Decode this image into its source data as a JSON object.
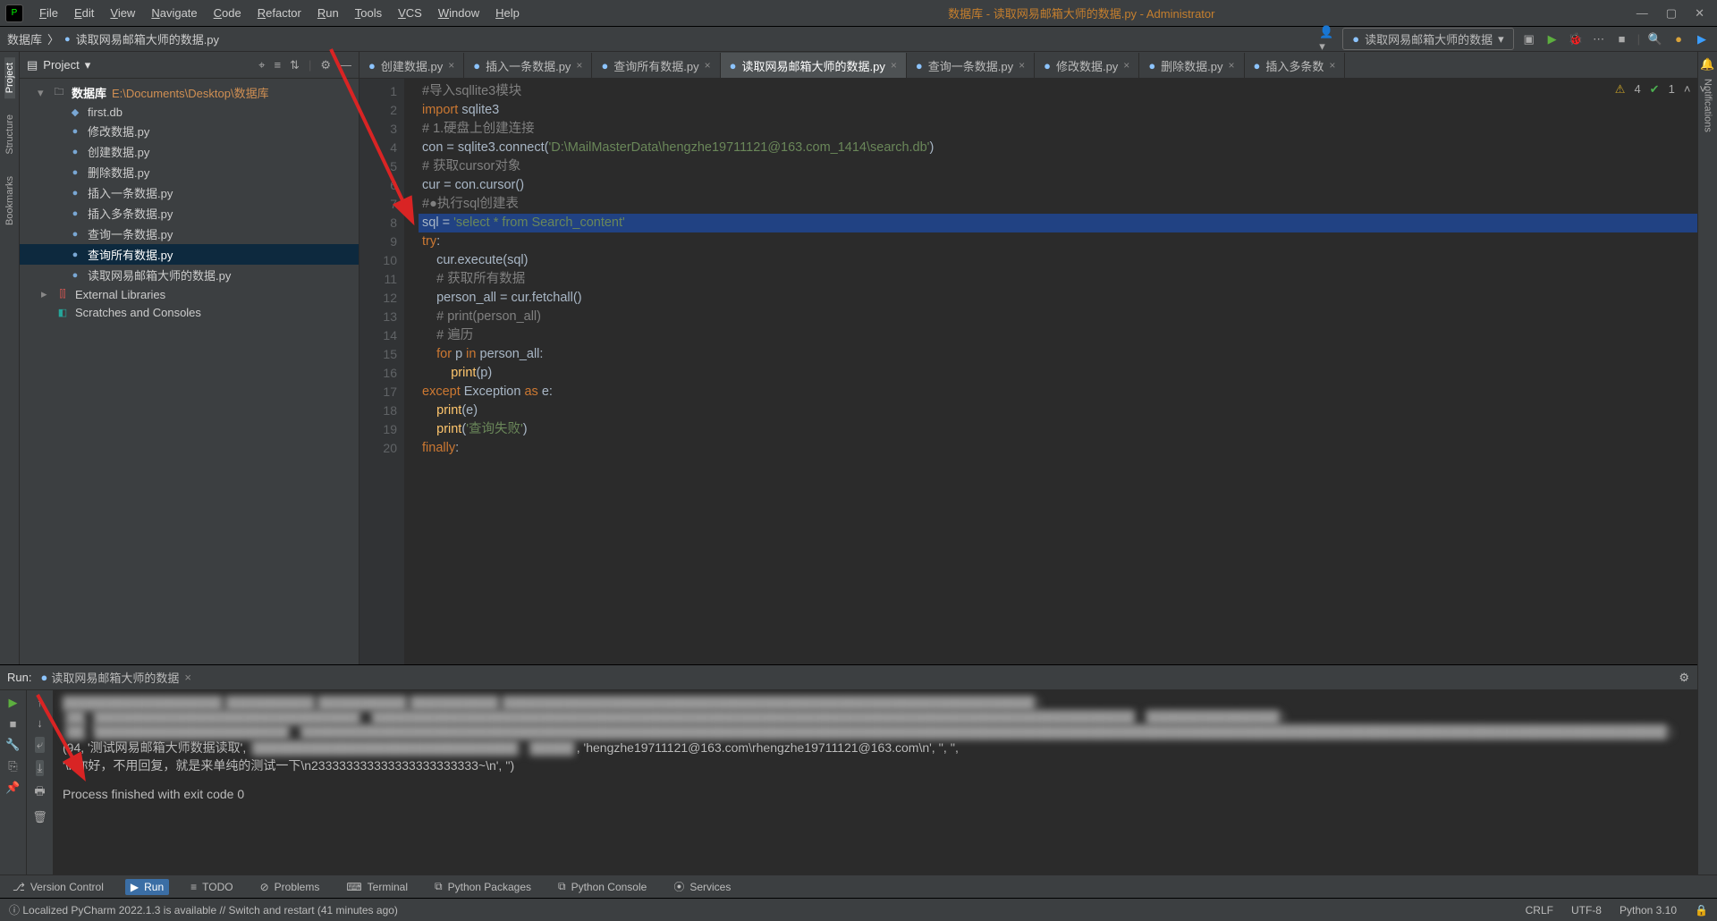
{
  "window": {
    "title": "数据库 - 读取网易邮箱大师的数据.py - Administrator"
  },
  "menu": [
    "File",
    "Edit",
    "View",
    "Navigate",
    "Code",
    "Refactor",
    "Run",
    "Tools",
    "VCS",
    "Window",
    "Help"
  ],
  "breadcrumbs": {
    "root": "数据库",
    "file": "读取网易邮箱大师的数据.py"
  },
  "run_config": "读取网易邮箱大师的数据",
  "project_pane": {
    "title": "Project",
    "root": {
      "name": "数据库",
      "path": "E:\\Documents\\Desktop\\数据库"
    },
    "files": [
      "first.db",
      "修改数据.py",
      "创建数据.py",
      "删除数据.py",
      "插入一条数据.py",
      "插入多条数据.py",
      "查询一条数据.py",
      "查询所有数据.py",
      "读取网易邮箱大师的数据.py"
    ],
    "selected_index": 7,
    "external": "External Libraries",
    "scratches": "Scratches and Consoles"
  },
  "tabs": [
    {
      "label": "创建数据.py",
      "active": false
    },
    {
      "label": "插入一条数据.py",
      "active": false
    },
    {
      "label": "查询所有数据.py",
      "active": false
    },
    {
      "label": "读取网易邮箱大师的数据.py",
      "active": true
    },
    {
      "label": "查询一条数据.py",
      "active": false
    },
    {
      "label": "修改数据.py",
      "active": false
    },
    {
      "label": "删除数据.py",
      "active": false
    },
    {
      "label": "插入多条数",
      "active": false
    }
  ],
  "inspection": {
    "warnings": "4",
    "oks": "1"
  },
  "code": {
    "lines": [
      {
        "n": 1,
        "seg": [
          {
            "c": "c-comment",
            "t": "#导入sqllite3模块"
          }
        ]
      },
      {
        "n": 2,
        "seg": [
          {
            "c": "c-kw",
            "t": "import "
          },
          {
            "c": "c-ident",
            "t": "sqlite3"
          }
        ]
      },
      {
        "n": 3,
        "seg": [
          {
            "c": "c-comment",
            "t": "# 1.硬盘上创建连接"
          }
        ]
      },
      {
        "n": 4,
        "seg": [
          {
            "c": "c-ident",
            "t": "con = sqlite3.connect("
          },
          {
            "c": "c-str",
            "t": "'D:\\MailMasterData\\hengzhe19711121@163.com_1414\\search.db'"
          },
          {
            "c": "c-ident",
            "t": ")"
          }
        ]
      },
      {
        "n": 5,
        "seg": [
          {
            "c": "c-comment",
            "t": "# 获取cursor对象"
          }
        ]
      },
      {
        "n": 6,
        "seg": [
          {
            "c": "c-ident",
            "t": "cur = con.cursor()"
          }
        ]
      },
      {
        "n": 7,
        "seg": [
          {
            "c": "c-comment",
            "t": "#●执行sql创建表"
          }
        ]
      },
      {
        "n": 8,
        "hl": true,
        "seg": [
          {
            "c": "c-ident",
            "t": "sql = "
          },
          {
            "c": "c-str",
            "t": "'select * from Search_content'"
          }
        ]
      },
      {
        "n": 9,
        "seg": [
          {
            "c": "c-kw",
            "t": "try"
          },
          {
            "c": "c-ident",
            "t": ":"
          }
        ]
      },
      {
        "n": 10,
        "seg": [
          {
            "c": "c-ident",
            "t": "    cur.execute(sql)"
          }
        ]
      },
      {
        "n": 11,
        "seg": [
          {
            "c": "c-comment",
            "t": "    # 获取所有数据"
          }
        ]
      },
      {
        "n": 12,
        "seg": [
          {
            "c": "c-ident",
            "t": "    person_all = cur.fetchall()"
          }
        ]
      },
      {
        "n": 13,
        "seg": [
          {
            "c": "c-comment",
            "t": "    # print(person_all)"
          }
        ]
      },
      {
        "n": 14,
        "seg": [
          {
            "c": "c-comment",
            "t": "    # 遍历"
          }
        ]
      },
      {
        "n": 15,
        "seg": [
          {
            "c": "c-ident",
            "t": "    "
          },
          {
            "c": "c-kw",
            "t": "for "
          },
          {
            "c": "c-ident",
            "t": "p "
          },
          {
            "c": "c-kw",
            "t": "in "
          },
          {
            "c": "c-ident",
            "t": "person_all:"
          }
        ]
      },
      {
        "n": 16,
        "seg": [
          {
            "c": "c-ident",
            "t": "        "
          },
          {
            "c": "c-func",
            "t": "print"
          },
          {
            "c": "c-ident",
            "t": "(p)"
          }
        ]
      },
      {
        "n": 17,
        "seg": [
          {
            "c": "c-kw",
            "t": "except "
          },
          {
            "c": "c-ident",
            "t": "Exception "
          },
          {
            "c": "c-kw",
            "t": "as "
          },
          {
            "c": "c-ident",
            "t": "e:"
          }
        ]
      },
      {
        "n": 18,
        "seg": [
          {
            "c": "c-ident",
            "t": "    "
          },
          {
            "c": "c-func",
            "t": "print"
          },
          {
            "c": "c-ident",
            "t": "(e)"
          }
        ]
      },
      {
        "n": 19,
        "seg": [
          {
            "c": "c-ident",
            "t": "    "
          },
          {
            "c": "c-func",
            "t": "print"
          },
          {
            "c": "c-ident",
            "t": "("
          },
          {
            "c": "c-str",
            "t": "'查询失败'"
          },
          {
            "c": "c-ident",
            "t": ")"
          }
        ]
      },
      {
        "n": 20,
        "seg": [
          {
            "c": "c-kw",
            "t": "finally"
          },
          {
            "c": "c-ident",
            "t": ":"
          }
        ]
      }
    ]
  },
  "run_panel": {
    "label": "Run:",
    "tab": "读取网易邮箱大师的数据",
    "blur1": "██████████████████ ██████████ ██████████ ██████████ ████████████████████████████████████████████████████████████')",
    "blur2": "(██, '██████████████████████████████', '██████████████████████████████████████████████████████████████████████████████████████', '███████████████')",
    "blur3": "(██, '██████████████████████', '██████████████████████████████████████████████████████████████████████████████████████████████████████████████████████████████████████████████████████████')",
    "line4a": "(94, '测试网易邮箱大师数据读取', ",
    "line4blur": "'██████████████████████████████', '█████'",
    "line4b": ", 'hengzhe19711121@163.com\\rhengzhe19711121@163.com\\n', '', '',",
    "line5": " '\\n你好，不用回复，就是来单纯的测试一下\\n233333333333333333333333~\\n', '')",
    "exit": "Process finished with exit code 0"
  },
  "statusbar_tabs": [
    "Version Control",
    "Run",
    "TODO",
    "Problems",
    "Terminal",
    "Python Packages",
    "Python Console",
    "Services"
  ],
  "statusbar_active": 1,
  "bottom": {
    "msg": "Localized PyCharm 2022.1.3 is available // Switch and restart (41 minutes ago)",
    "right": [
      "CRLF",
      "UTF-8",
      "Python 3.10"
    ]
  },
  "right_rail": "Notifications",
  "left_rail": [
    "Project",
    "Structure",
    "Bookmarks"
  ]
}
